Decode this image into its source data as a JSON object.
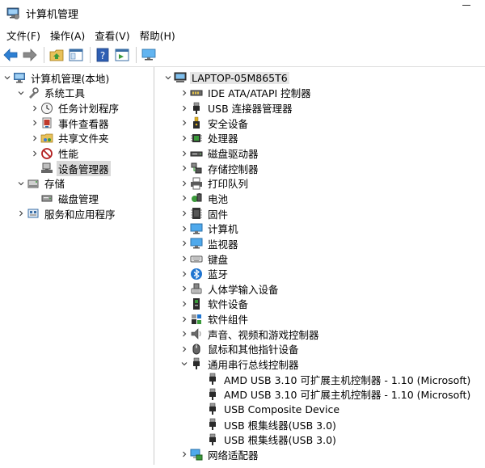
{
  "window": {
    "title": "计算机管理"
  },
  "menu": [
    "文件(F)",
    "操作(A)",
    "查看(V)",
    "帮助(H)"
  ],
  "left_tree": [
    {
      "label": "计算机管理(本地)",
      "depth": 0,
      "exp": "open",
      "icon": "computer-management-icon"
    },
    {
      "label": "系统工具",
      "depth": 1,
      "exp": "open",
      "icon": "tools-icon"
    },
    {
      "label": "任务计划程序",
      "depth": 2,
      "exp": "closed",
      "icon": "clock-icon"
    },
    {
      "label": "事件查看器",
      "depth": 2,
      "exp": "closed",
      "icon": "event-viewer-icon"
    },
    {
      "label": "共享文件夹",
      "depth": 2,
      "exp": "closed",
      "icon": "shared-folder-icon"
    },
    {
      "label": "性能",
      "depth": 2,
      "exp": "closed",
      "icon": "no-sign-icon"
    },
    {
      "label": "设备管理器",
      "depth": 2,
      "exp": "none",
      "icon": "device-manager-icon",
      "state": "selected"
    },
    {
      "label": "存储",
      "depth": 1,
      "exp": "open",
      "icon": "storage-icon"
    },
    {
      "label": "磁盘管理",
      "depth": 2,
      "exp": "none",
      "icon": "disk-management-icon"
    },
    {
      "label": "服务和应用程序",
      "depth": 1,
      "exp": "closed",
      "icon": "services-icon"
    }
  ],
  "right_tree": [
    {
      "label": "LAPTOP-05M865T6",
      "depth": 0,
      "exp": "open",
      "icon": "computer-icon",
      "state": "highlight"
    },
    {
      "label": "IDE ATA/ATAPI 控制器",
      "depth": 1,
      "exp": "closed",
      "icon": "ide-controller-icon"
    },
    {
      "label": "USB 连接器管理器",
      "depth": 1,
      "exp": "closed",
      "icon": "usb-plug-icon"
    },
    {
      "label": "安全设备",
      "depth": 1,
      "exp": "closed",
      "icon": "security-device-icon"
    },
    {
      "label": "处理器",
      "depth": 1,
      "exp": "closed",
      "icon": "processor-icon"
    },
    {
      "label": "磁盘驱动器",
      "depth": 1,
      "exp": "closed",
      "icon": "disk-drive-icon"
    },
    {
      "label": "存储控制器",
      "depth": 1,
      "exp": "closed",
      "icon": "storage-controller-icon"
    },
    {
      "label": "打印队列",
      "depth": 1,
      "exp": "closed",
      "icon": "printer-icon"
    },
    {
      "label": "电池",
      "depth": 1,
      "exp": "closed",
      "icon": "battery-icon"
    },
    {
      "label": "固件",
      "depth": 1,
      "exp": "closed",
      "icon": "firmware-icon"
    },
    {
      "label": "计算机",
      "depth": 1,
      "exp": "closed",
      "icon": "monitor-icon"
    },
    {
      "label": "监视器",
      "depth": 1,
      "exp": "closed",
      "icon": "monitor-icon"
    },
    {
      "label": "键盘",
      "depth": 1,
      "exp": "closed",
      "icon": "keyboard-icon"
    },
    {
      "label": "蓝牙",
      "depth": 1,
      "exp": "closed",
      "icon": "bluetooth-icon"
    },
    {
      "label": "人体学输入设备",
      "depth": 1,
      "exp": "closed",
      "icon": "hid-icon"
    },
    {
      "label": "软件设备",
      "depth": 1,
      "exp": "closed",
      "icon": "software-device-icon"
    },
    {
      "label": "软件组件",
      "depth": 1,
      "exp": "closed",
      "icon": "software-component-icon"
    },
    {
      "label": "声音、视频和游戏控制器",
      "depth": 1,
      "exp": "closed",
      "icon": "speaker-icon"
    },
    {
      "label": "鼠标和其他指针设备",
      "depth": 1,
      "exp": "closed",
      "icon": "mouse-icon"
    },
    {
      "label": "通用串行总线控制器",
      "depth": 1,
      "exp": "open",
      "icon": "usb-plug-icon"
    },
    {
      "label": "AMD USB 3.10 可扩展主机控制器 - 1.10 (Microsoft)",
      "depth": 2,
      "exp": "none",
      "icon": "usb-plug-icon"
    },
    {
      "label": "AMD USB 3.10 可扩展主机控制器 - 1.10 (Microsoft)",
      "depth": 2,
      "exp": "none",
      "icon": "usb-plug-icon"
    },
    {
      "label": "USB Composite Device",
      "depth": 2,
      "exp": "none",
      "icon": "usb-plug-icon"
    },
    {
      "label": "USB 根集线器(USB 3.0)",
      "depth": 2,
      "exp": "none",
      "icon": "usb-plug-icon"
    },
    {
      "label": "USB 根集线器(USB 3.0)",
      "depth": 2,
      "exp": "none",
      "icon": "usb-plug-icon"
    },
    {
      "label": "网络适配器",
      "depth": 1,
      "exp": "closed",
      "icon": "network-adapter-icon"
    }
  ]
}
